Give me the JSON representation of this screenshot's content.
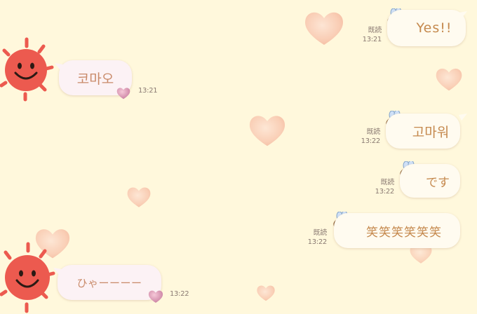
{
  "chat": {
    "messages": [
      {
        "id": "m1",
        "direction": "outgoing",
        "text": "Yes!!",
        "read": "既読",
        "time": "13:21",
        "sticker": "bee-icon"
      },
      {
        "id": "m2",
        "direction": "incoming",
        "text": "코마오",
        "time": "13:21",
        "reaction": "heart-icon"
      },
      {
        "id": "m3",
        "direction": "outgoing",
        "text": "고마워",
        "read": "既読",
        "time": "13:22",
        "sticker": "bee-icon"
      },
      {
        "id": "m4",
        "direction": "outgoing",
        "text": "です",
        "read": "既読",
        "time": "13:22",
        "sticker": "bee-icon"
      },
      {
        "id": "m5",
        "direction": "outgoing",
        "text": "笑笑笑笑笑笑",
        "read": "既読",
        "time": "13:22",
        "sticker": "bee-icon"
      },
      {
        "id": "m6",
        "direction": "incoming",
        "text": "ひゃーーーー",
        "time": "13:22",
        "reaction": "heart-icon"
      }
    ]
  },
  "theme": {
    "background": "#fff8dc",
    "outgoing_text": "#c5894e",
    "incoming_bubble": "#fcf2f5",
    "sun_color": "#ec5a4f",
    "heart_color": "#f6c1a7"
  }
}
